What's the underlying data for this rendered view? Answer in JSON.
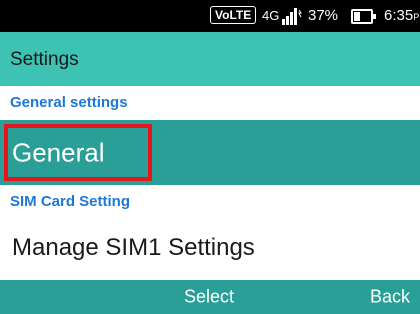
{
  "status_bar": {
    "volte": "VoLTE",
    "network": "4G",
    "battery_percent": "37%",
    "time": "6:35",
    "ampm": "PM"
  },
  "title": "Settings",
  "sections": {
    "general_header": "General settings",
    "sim_header": "SIM Card Setting"
  },
  "items": {
    "general": "General",
    "manage_sim": "Manage SIM1 Settings"
  },
  "softkeys": {
    "select": "Select",
    "back": "Back"
  },
  "colors": {
    "title_bar": "#3ec2b3",
    "selected_row": "#2a9f97",
    "section_header": "#1e78d8",
    "highlight": "#e8141c"
  }
}
